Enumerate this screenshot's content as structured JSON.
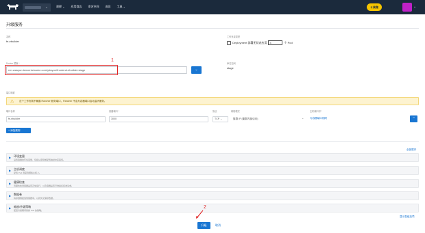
{
  "topbar": {
    "nav": [
      "观察 ⌄",
      "应用商店",
      "命名空间",
      "成员",
      "工具 ⌄"
    ],
    "upgrade_label": "ㄐ来做",
    "colors": {
      "bg": "#1b2a3c",
      "accent": "#f5c400",
      "avatar": "#c021c8"
    }
  },
  "page": {
    "title": "升级服务"
  },
  "form": {
    "name_label": "名称",
    "name_value": "fe-ebuilder",
    "workload_label": "工作负载类型",
    "workload_value": "Deployment 部署无状态应用",
    "pods_value": "3",
    "pods_suffix": "个 Pod",
    "docker_label": "Docker 镜像 *",
    "docker_value": "ren.wasyun.tencentcloudcr.com/ydayun/frontend-ebuilder:stage",
    "namespace_label": "命名空间",
    "namespace_value": "stage",
    "ports_label": "端口映射",
    "warning": "这个工作负载不暴露 Rancher 服务端口，Rancher 不会为容器端口启动监听服务。",
    "port_headers": [
      "端口名称",
      "容器端口 *",
      "协议",
      "网络模式",
      "主机端口号 *"
    ],
    "port_row": {
      "name": "fe-ebuilder",
      "container_port": "3000",
      "protocol": "TCP",
      "mode": "集群 IP (集群内部访问)",
      "host_port": "与容器端口相同"
    },
    "add_rule": "添加规则"
  },
  "sections": [
    {
      "title": "环境变量",
      "sub": "设置容器的环境变量，包括从密钥或配置映射中获取值。"
    },
    {
      "title": "主机调度",
      "sub": "配置 Pod 调度到哪些主机上。"
    },
    {
      "title": "健康检查",
      "sub": "周期性检测容器是否正常运行，以及容器是否已准备好接收请求。"
    },
    {
      "title": "数据卷",
      "sub": "将存储卷挂载到容器中，以持久化保存数据。"
    },
    {
      "title": "缩放/升级策略",
      "sub": "配置升级期间替换 Pod 的策略。"
    }
  ],
  "links": {
    "expand_all": "全部展开",
    "show_advanced": "显示高级选项"
  },
  "actions": {
    "upgrade": "升级",
    "cancel": "取消"
  },
  "annotations": {
    "one": "1",
    "two": "2"
  }
}
